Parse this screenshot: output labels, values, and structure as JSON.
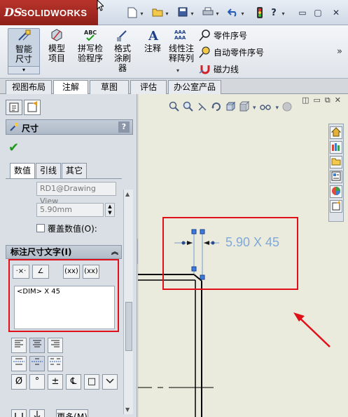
{
  "app": {
    "logo_ds": "DS",
    "logo_text": "SOLIDWORKS"
  },
  "quick_access": {
    "items": [
      "new-icon",
      "open-icon",
      "save-icon",
      "print-icon",
      "undo-icon",
      "rebuild-icon",
      "help-icon"
    ]
  },
  "commands": {
    "smart_dimension": "智能尺寸",
    "model_items": "模型项目",
    "spell_check": "拼写检验程序",
    "format_painter": "格式涂刷器",
    "note": "注释",
    "linear_pattern": "线性注释阵列",
    "balloon": "零件序号",
    "auto_balloon": "自动零件序号",
    "magnetic_line": "磁力线"
  },
  "tabs": [
    {
      "label": "视图布局",
      "active": false
    },
    {
      "label": "注解",
      "active": true
    },
    {
      "label": "草图",
      "active": false
    },
    {
      "label": "评估",
      "active": false
    },
    {
      "label": "办公室产品",
      "active": false
    }
  ],
  "property_manager": {
    "title": "尺寸",
    "help": "?",
    "sub_tabs": [
      {
        "label": "数值",
        "active": true
      },
      {
        "label": "引线",
        "active": false
      },
      {
        "label": "其它",
        "active": false
      }
    ],
    "reference_field": "RD1@Drawing View",
    "value_field": "5.90mm",
    "override_label": "覆盖数值(O):",
    "dim_text_group": "标注尺寸文字(I)",
    "dim_text_content": "<DIM> X 45",
    "insert_buttons": [
      "·×·",
      "∠",
      "(xx)",
      "(xx)"
    ],
    "more_button": "更多(M)",
    "align_buttons": [
      "≡",
      "≡",
      "≡"
    ],
    "symbol_buttons": [
      "Ø",
      "°",
      "±",
      "℄",
      "□"
    ]
  },
  "graphics": {
    "dimension_text": "5.90 X 45"
  }
}
